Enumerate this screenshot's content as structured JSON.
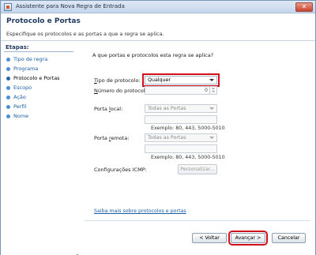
{
  "window": {
    "title": "Assistente para Nova Regra de Entrada",
    "close_label": "✕"
  },
  "header": {
    "title": "Protocolo e Portas",
    "description": "Especifique os protocolos e as portas a que a regra se aplica."
  },
  "sidebar": {
    "title": "Etapas:",
    "steps": [
      {
        "label": "Tipo de regra"
      },
      {
        "label": "Programa"
      },
      {
        "label": "Protocolo e Portas"
      },
      {
        "label": "Escopo"
      },
      {
        "label": "Ação"
      },
      {
        "label": "Perfil"
      },
      {
        "label": "Nome"
      }
    ]
  },
  "form": {
    "question": "A que portas e protocolos esta regra se aplica?",
    "protocol_type": {
      "label_prefix": "T",
      "label_rest": "ipo de protocolo:",
      "value": "Qualquer"
    },
    "protocol_number": {
      "label_prefix": "N",
      "label_rest": "úmero do protocolo:",
      "value": "0"
    },
    "local_port": {
      "label_prefix": "Porta ",
      "label_u": "l",
      "label_rest": "ocal:",
      "value": "Todas as Portas",
      "example": "Exemplo: 80, 443, 5000-5010"
    },
    "remote_port": {
      "label_prefix": "Porta ",
      "label_u": "r",
      "label_rest": "emota:",
      "value": "Todas as Portas",
      "example": "Exemplo: 80, 443, 5000-5010"
    },
    "icmp": {
      "label": "Configurações ICMP:",
      "button": "Personalizar..."
    },
    "learn_more": "Saiba mais sobre protocolos e portas"
  },
  "buttons": {
    "back": "< Voltar",
    "next": "Avançar >",
    "cancel": "Cancelar"
  }
}
